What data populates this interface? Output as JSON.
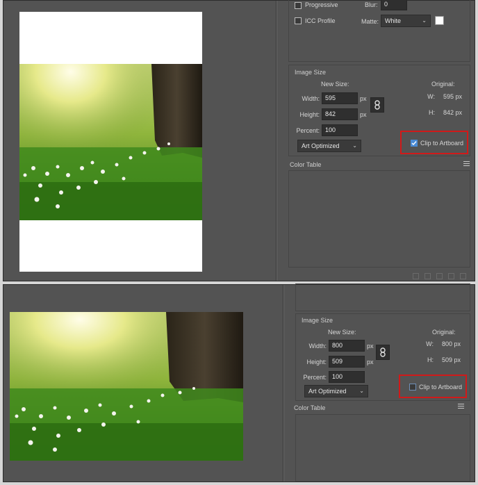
{
  "top": {
    "opts": {
      "progressive_label": "Progressive",
      "blur_label": "Blur:",
      "blur_value": "0",
      "icc_label": "ICC Profile",
      "matte_label": "Matte:",
      "matte_value": "White"
    },
    "image_size": {
      "title": "Image Size",
      "new_size_label": "New Size:",
      "original_label": "Original:",
      "width_label": "Width:",
      "width_value": "595",
      "height_label": "Height:",
      "height_value": "842",
      "unit_px_1": "px",
      "unit_px_2": "px",
      "percent_label": "Percent:",
      "percent_value": "100",
      "orig_w_label": "W:",
      "orig_w_value": "595 px",
      "orig_h_label": "H:",
      "orig_h_value": "842 px",
      "quality_value": "Art Optimized",
      "clip_label": "Clip to Artboard",
      "clip_checked": true
    },
    "color_table": {
      "title": "Color Table"
    }
  },
  "bottom": {
    "image_size": {
      "title": "Image Size",
      "new_size_label": "New Size:",
      "original_label": "Original:",
      "width_label": "Width:",
      "width_value": "800",
      "height_label": "Height:",
      "height_value": "509",
      "unit_px_1": "px",
      "unit_px_2": "px",
      "percent_label": "Percent:",
      "percent_value": "100",
      "orig_w_label": "W:",
      "orig_w_value": "800 px",
      "orig_h_label": "H:",
      "orig_h_value": "509 px",
      "quality_value": "Art Optimized",
      "clip_label": "Clip to Artboard",
      "clip_checked": false
    },
    "color_table": {
      "title": "Color Table"
    }
  },
  "colors": {
    "panel_bg": "#535353",
    "highlight_red": "#d11919",
    "checkbox_blue": "#4a8ad4"
  },
  "icons": [
    "chain-link-icon",
    "chevron-down-icon",
    "panel-menu-icon",
    "checkmark-icon"
  ]
}
